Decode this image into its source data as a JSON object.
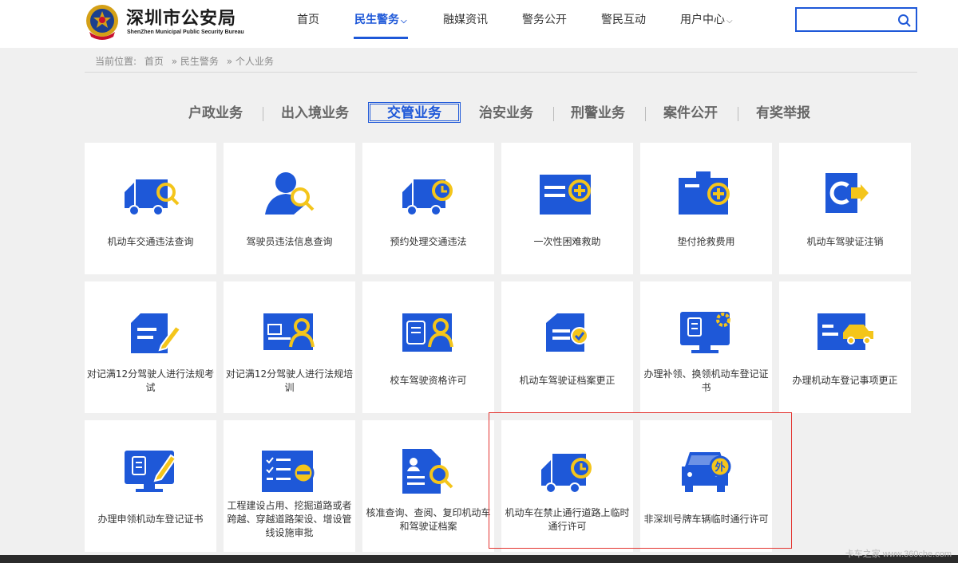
{
  "header": {
    "logo_cn": "深圳市公安局",
    "logo_en": "ShenZhen Municipal Public Security Bureau",
    "nav": [
      {
        "label": "首页"
      },
      {
        "label": "民生警务"
      },
      {
        "label": "融媒资讯"
      },
      {
        "label": "警务公开"
      },
      {
        "label": "警民互动"
      },
      {
        "label": "用户中心"
      }
    ],
    "active_nav": "民生警务",
    "search_placeholder": "",
    "accent_color": "#1e58d8"
  },
  "breadcrumb": {
    "prefix": "当前位置:",
    "items": [
      "首页",
      "» 民生警务",
      "» 个人业务"
    ]
  },
  "tabs": [
    {
      "label": "户政业务"
    },
    {
      "label": "出入境业务"
    },
    {
      "label": "交管业务"
    },
    {
      "label": "治安业务"
    },
    {
      "label": "刑警业务"
    },
    {
      "label": "案件公开"
    },
    {
      "label": "有奖举报"
    }
  ],
  "active_tab": "交管业务",
  "tiles": [
    {
      "label": "机动车交通违法查询",
      "icon": "truck-search-icon"
    },
    {
      "label": "驾驶员违法信息查询",
      "icon": "driver-search-icon"
    },
    {
      "label": "预约处理交通违法",
      "icon": "truck-clock-icon"
    },
    {
      "label": "一次性困难救助",
      "icon": "card-plus-icon"
    },
    {
      "label": "垫付抢救费用",
      "icon": "medkit-plus-icon"
    },
    {
      "label": "机动车驾驶证注销",
      "icon": "license-cancel-icon"
    },
    {
      "label": "对记满12分驾驶人进行法规考试",
      "icon": "document-pen-icon"
    },
    {
      "label": "对记满12分驾驶人进行法规培训",
      "icon": "board-person-icon"
    },
    {
      "label": "校车驾驶资格许可",
      "icon": "document-person-icon"
    },
    {
      "label": "机动车驾驶证档案更正",
      "icon": "card-check-icon"
    },
    {
      "label": "办理补领、换领机动车登记证书",
      "icon": "monitor-gear-icon"
    },
    {
      "label": "办理机动车登记事项更正",
      "icon": "card-car-icon"
    },
    {
      "label": "办理申领机动车登记证书",
      "icon": "monitor-pen-icon"
    },
    {
      "label": "工程建设占用、挖掘道路或者跨越、穿越道路架设、增设管线设施审批",
      "icon": "checklist-minus-icon"
    },
    {
      "label": "核准查询、查阅、复印机动车和驾驶证档案",
      "icon": "file-search-icon"
    },
    {
      "label": "机动车在禁止通行道路上临时通行许可",
      "icon": "truck-clock-icon"
    },
    {
      "label": "非深圳号牌车辆临时通行许可",
      "icon": "car-foreign-icon"
    }
  ],
  "highlight_color": "#e3332f",
  "watermark": "卡车之家 www.360che.com"
}
